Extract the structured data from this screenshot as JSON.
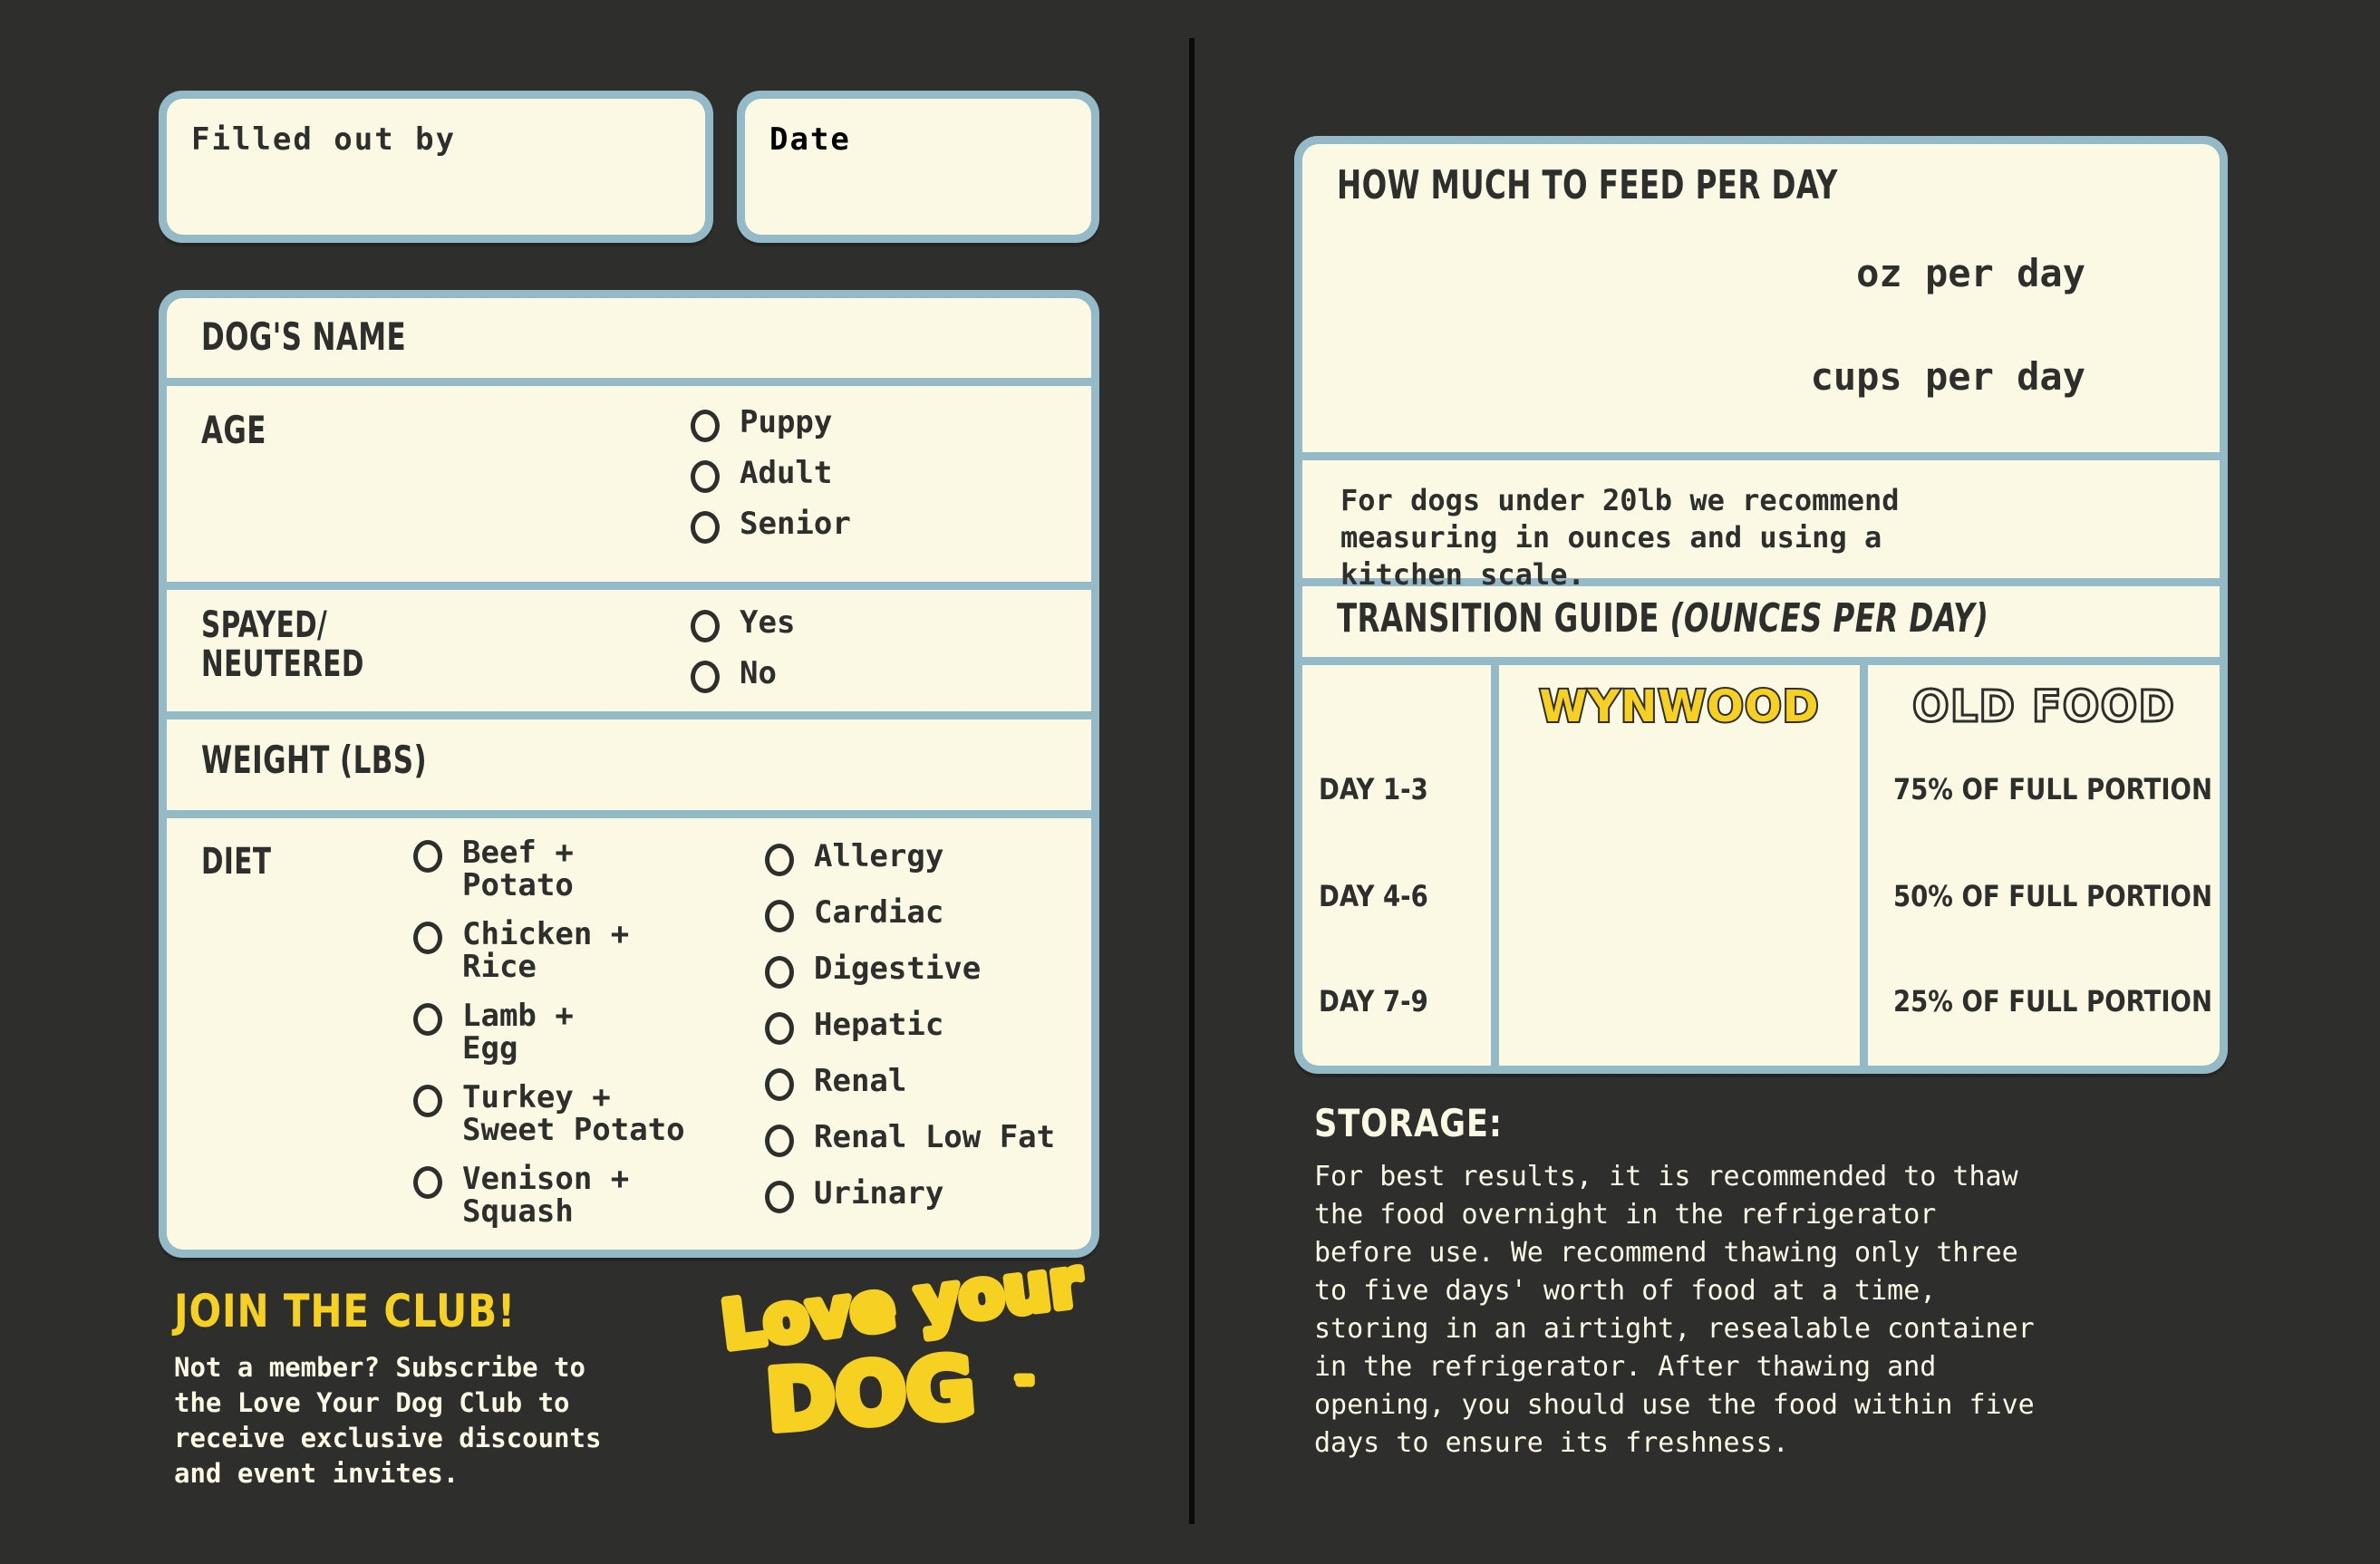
{
  "theme": {
    "background": "#2e2e2d",
    "card_border": "#93bac6",
    "card_fill": "#fbf8e4",
    "ink": "#2e2e2d",
    "accent_yellow": "#f7d122",
    "cream_text": "#fbf8e4"
  },
  "left": {
    "filled_out_by_label": "Filled out by",
    "date_label": "Date",
    "dogs_name_label": "DOG'S NAME",
    "age": {
      "label": "AGE",
      "options": [
        "Puppy",
        "Adult",
        "Senior"
      ]
    },
    "spayed": {
      "label": "SPAYED/\nNEUTERED",
      "options": [
        "Yes",
        "No"
      ]
    },
    "weight_label": "WEIGHT (LBS)",
    "diet": {
      "label": "DIET",
      "recipes": [
        "Beef +\nPotato",
        "Chicken +\nRice",
        "Lamb +\nEgg",
        "Turkey +\nSweet Potato",
        "Venison +\nSquash"
      ],
      "conditions": [
        "Allergy",
        "Cardiac",
        "Digestive",
        "Hepatic",
        "Renal",
        "Renal Low Fat",
        "Urinary"
      ]
    },
    "join": {
      "title": "JOIN THE CLUB!",
      "body": "Not a member? Subscribe to\nthe Love Your Dog Club to\nreceive exclusive discounts\nand event invites."
    },
    "logo": {
      "line1": "Love your",
      "line2": "DOG",
      "trademark": "™"
    }
  },
  "right": {
    "feed": {
      "title": "HOW MUCH TO FEED PER DAY",
      "oz_label": "oz per day",
      "cups_label": "cups per day",
      "note": "For dogs under 20lb we recommend\nmeasuring in ounces and using a\nkitchen scale."
    },
    "transition": {
      "title_main": "TRANSITION GUIDE ",
      "title_paren": "(OUNCES PER DAY)",
      "columns": [
        "",
        "WYNWOOD",
        "OLD FOOD"
      ],
      "rows": [
        {
          "day": "DAY 1-3",
          "wynwood": "",
          "old_food": "75% OF FULL PORTION"
        },
        {
          "day": "DAY 4-6",
          "wynwood": "",
          "old_food": "50% OF FULL PORTION"
        },
        {
          "day": "DAY 7-9",
          "wynwood": "",
          "old_food": "25% OF FULL PORTION"
        }
      ]
    },
    "storage": {
      "title": "STORAGE:",
      "body": "For best results, it is recommended to thaw\nthe food overnight in the refrigerator\nbefore use. We recommend thawing only three\nto five days' worth of food at a time,\nstoring in an airtight, resealable container\nin the refrigerator. After thawing and\nopening, you should use the food within five\ndays to ensure its freshness."
    }
  }
}
